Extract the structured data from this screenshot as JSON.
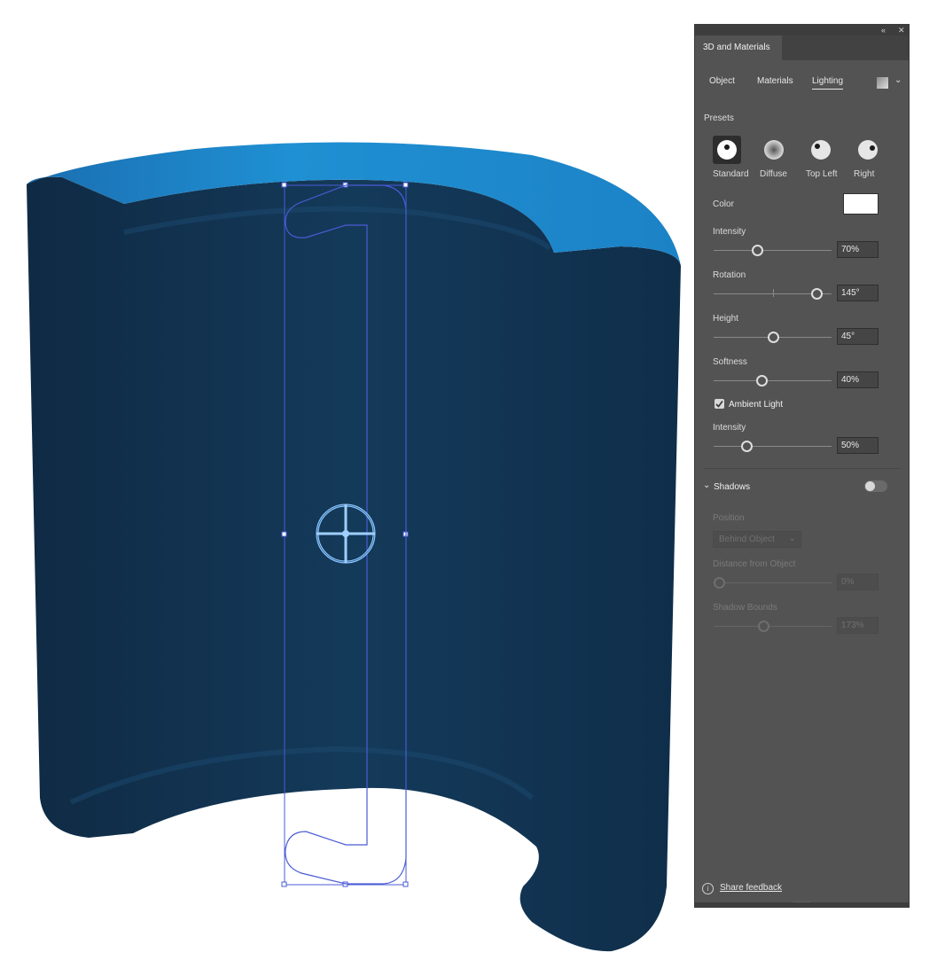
{
  "panel": {
    "title": "3D and Materials",
    "subtabs": [
      {
        "label": "Object",
        "active": false
      },
      {
        "label": "Materials",
        "active": false
      },
      {
        "label": "Lighting",
        "active": true
      }
    ],
    "presets_label": "Presets",
    "presets": [
      {
        "label": "Standard",
        "icon": "standard-light-icon",
        "selected": true
      },
      {
        "label": "Diffuse",
        "icon": "diffuse-light-icon",
        "selected": false
      },
      {
        "label": "Top Left",
        "icon": "top-left-light-icon",
        "selected": false
      },
      {
        "label": "Right",
        "icon": "right-light-icon",
        "selected": false
      }
    ],
    "color_label": "Color",
    "color_value": "#ffffff",
    "intensity": {
      "label": "Intensity",
      "value": "70%",
      "fraction": 0.36
    },
    "rotation": {
      "label": "Rotation",
      "value": "145°",
      "fraction": 0.87
    },
    "height": {
      "label": "Height",
      "value": "45°",
      "fraction": 0.5
    },
    "softness": {
      "label": "Softness",
      "value": "40%",
      "fraction": 0.4
    },
    "ambient": {
      "label": "Ambient Light",
      "checked": true
    },
    "ambient_intensity": {
      "label": "Intensity",
      "value": "50%",
      "fraction": 0.27
    },
    "shadows": {
      "label": "Shadows",
      "enabled": false,
      "position_label": "Position",
      "position_value": "Behind Object",
      "distance_label": "Distance from Object",
      "distance_value": "0%",
      "bounds_label": "Shadow Bounds",
      "bounds_value": "173%"
    },
    "share_feedback": "Share feedback"
  },
  "colors": {
    "object_dark": "#133552",
    "object_top": "#1c8ed0",
    "selection": "#4a5bd6",
    "panel_bg": "#535353"
  }
}
